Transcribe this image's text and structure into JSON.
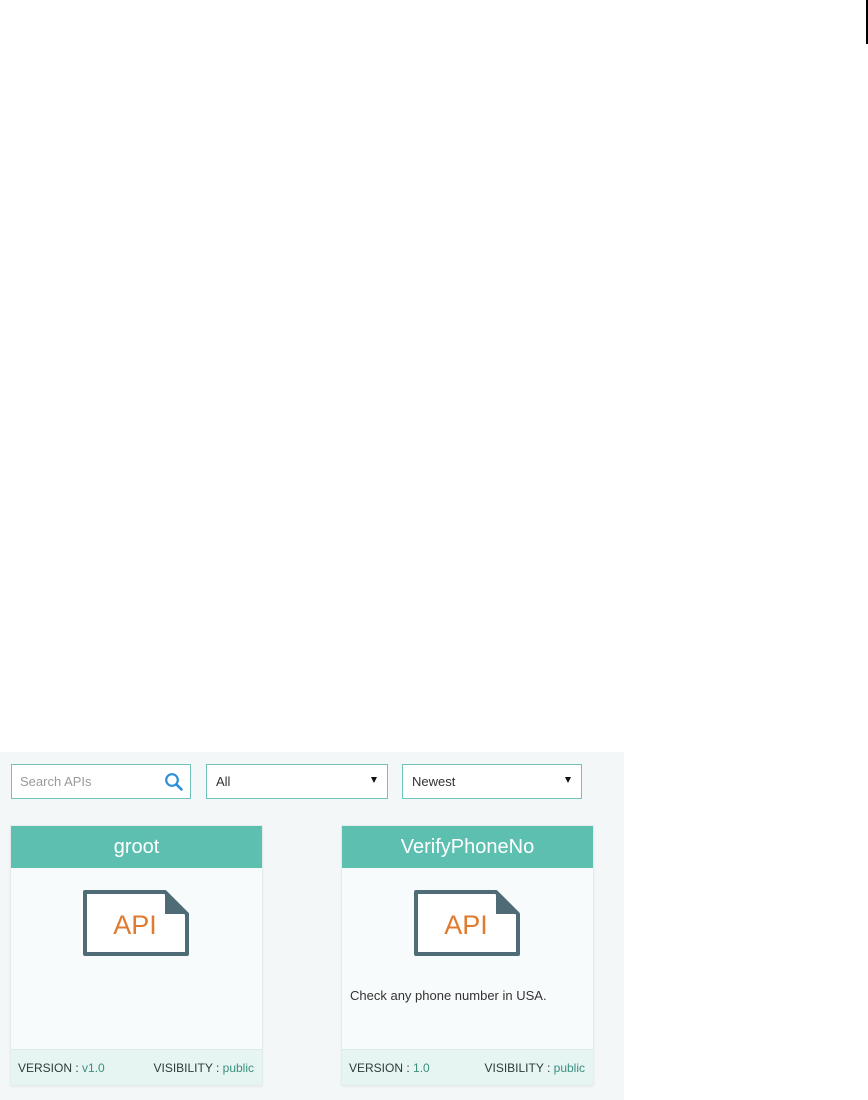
{
  "search": {
    "placeholder": "Search APIs"
  },
  "filters": {
    "category_selected": "All",
    "sort_selected": "Newest"
  },
  "colors": {
    "accent": "#5cbfb0",
    "api_text": "#e07a2f",
    "api_frame": "#4f6b75"
  },
  "cards": [
    {
      "title": "groot",
      "logo_text": "API",
      "description": "",
      "version_label": "VERSION :",
      "version": "v1.0",
      "visibility_label": "VISIBILITY :",
      "visibility": "public"
    },
    {
      "title": "VerifyPhoneNo",
      "logo_text": "API",
      "description": "Check any phone number in USA.",
      "version_label": "VERSION :",
      "version": "1.0",
      "visibility_label": "VISIBILITY :",
      "visibility": "public"
    }
  ]
}
